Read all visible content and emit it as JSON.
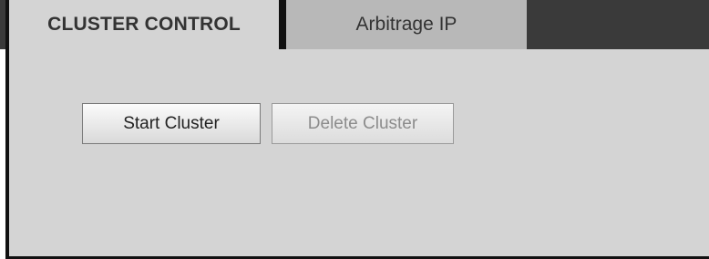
{
  "tabs": [
    {
      "label": "CLUSTER CONTROL",
      "active": true
    },
    {
      "label": "Arbitrage IP",
      "active": false
    }
  ],
  "buttons": {
    "start": {
      "label": "Start Cluster",
      "enabled": true
    },
    "delete": {
      "label": "Delete Cluster",
      "enabled": false
    }
  },
  "colors": {
    "panel_bg": "#d4d4d4",
    "tab_inactive_bg": "#b8b8b8",
    "tabbar_bg": "#3a3a3a",
    "border": "#111111",
    "disabled_text": "#8c8c8c"
  }
}
